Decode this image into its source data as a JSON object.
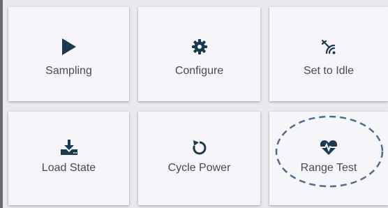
{
  "tiles": [
    {
      "label": "Sampling",
      "icon": "play-icon"
    },
    {
      "label": "Configure",
      "icon": "gear-icon"
    },
    {
      "label": "Set to Idle",
      "icon": "signal-off-icon"
    },
    {
      "label": "Load State",
      "icon": "download-icon"
    },
    {
      "label": "Cycle Power",
      "icon": "restart-icon"
    },
    {
      "label": "Range Test",
      "icon": "heart-pulse-icon"
    }
  ],
  "colors": {
    "icon": "#1c3a4f",
    "label": "#4a4a4a",
    "tile": "#f6f5f9",
    "highlight_ellipse": "#4f6c8e"
  }
}
